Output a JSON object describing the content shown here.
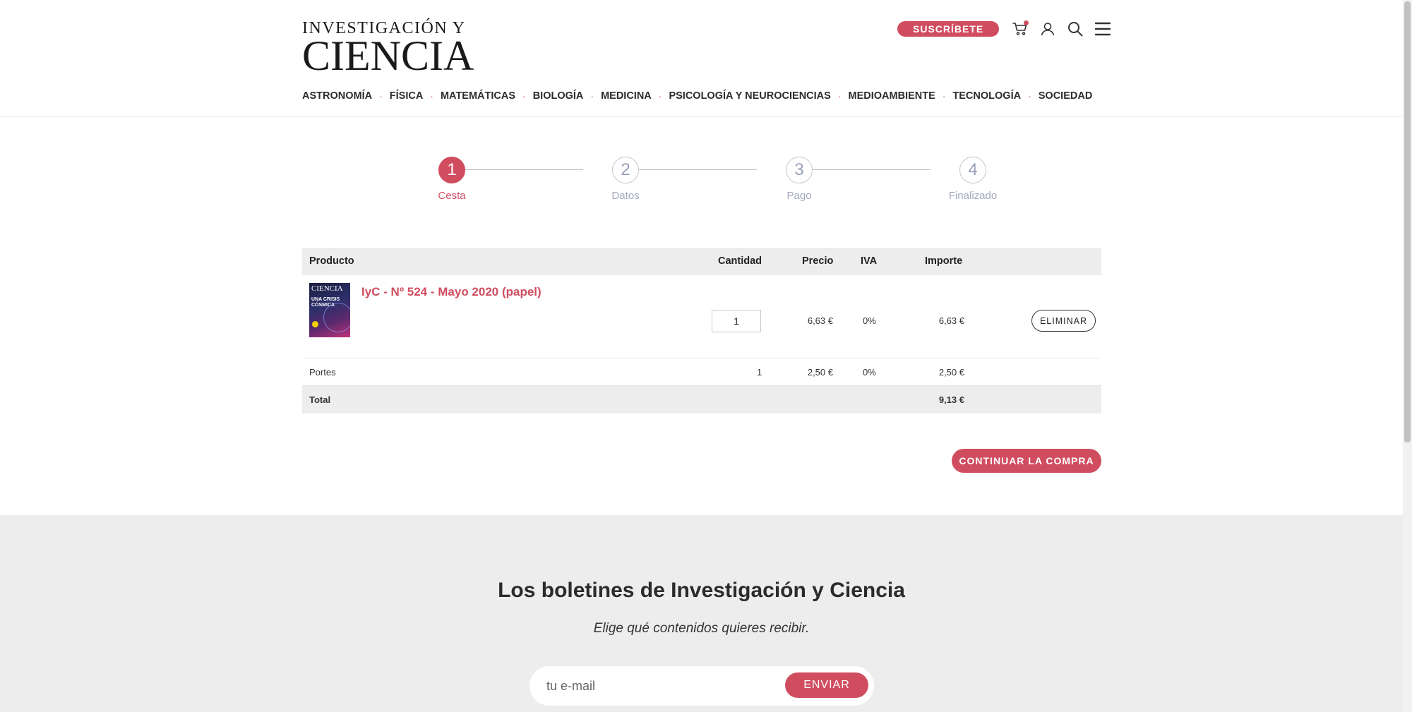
{
  "header": {
    "logo_top": "INVESTIGACIÓN Y",
    "logo_bottom": "CIENCIA",
    "subscribe_label": "SUSCRÍBETE"
  },
  "nav": {
    "items": [
      "ASTRONOMÍA",
      "FÍSICA",
      "MATEMÁTICAS",
      "BIOLOGÍA",
      "MEDICINA",
      "PSICOLOGÍA Y NEUROCIENCIAS",
      "MEDIOAMBIENTE",
      "TECNOLOGÍA",
      "SOCIEDAD"
    ],
    "separator": "·"
  },
  "stepper": {
    "steps": [
      {
        "number": "1",
        "label": "Cesta",
        "active": true
      },
      {
        "number": "2",
        "label": "Datos",
        "active": false
      },
      {
        "number": "3",
        "label": "Pago",
        "active": false
      },
      {
        "number": "4",
        "label": "Finalizado",
        "active": false
      }
    ]
  },
  "cart": {
    "headers": {
      "product": "Producto",
      "quantity": "Cantidad",
      "price": "Precio",
      "vat": "IVA",
      "amount": "Importe"
    },
    "item": {
      "cover_title": "CIENCIA",
      "cover_headline": "UNA CRISIS CÓSMICA",
      "name": "IyC - Nº 524 - Mayo 2020 (papel)",
      "quantity": "1",
      "price": "6,63 €",
      "vat": "0%",
      "amount": "6,63 €",
      "remove_label": "ELIMINAR"
    },
    "shipping": {
      "label": "Portes",
      "quantity": "1",
      "price": "2,50 €",
      "vat": "0%",
      "amount": "2,50 €"
    },
    "total": {
      "label": "Total",
      "amount": "9,13 €"
    },
    "continue_label": "CONTINUAR LA COMPRA"
  },
  "newsletter": {
    "title": "Los boletines de Investigación y Ciencia",
    "subtitle": "Elige qué contenidos quieres recibir.",
    "email_placeholder": "tu e-mail",
    "submit_label": "ENVIAR"
  },
  "colors": {
    "accent": "#d04d60",
    "table_header_bg": "#ededed",
    "footer_bg": "#ededed"
  },
  "icons": {
    "cart": "cart-icon",
    "user": "user-icon",
    "search": "search-icon",
    "menu": "hamburger-menu-icon"
  }
}
